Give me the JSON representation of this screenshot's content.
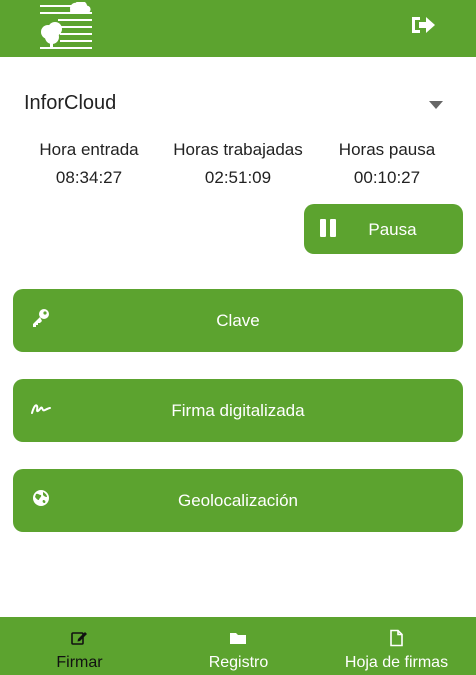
{
  "app": {
    "brand_color": "#5ca32f",
    "logo_icon": "tree-cloud-logo",
    "logout_icon": "logout-icon"
  },
  "company": {
    "selected": "InforCloud"
  },
  "stats": [
    {
      "label": "Hora entrada",
      "value": "08:34:27"
    },
    {
      "label": "Horas trabajadas",
      "value": "02:51:09"
    },
    {
      "label": "Horas pausa",
      "value": "00:10:27"
    }
  ],
  "pause_button": {
    "label": "Pausa",
    "icon": "pause-icon"
  },
  "actions": [
    {
      "label": "Clave",
      "icon": "key-icon"
    },
    {
      "label": "Firma digitalizada",
      "icon": "signature-icon"
    },
    {
      "label": "Geolocalización",
      "icon": "globe-icon"
    }
  ],
  "bottom_nav": [
    {
      "label": "Firmar",
      "icon": "edit-icon",
      "active": true
    },
    {
      "label": "Registro",
      "icon": "folder-icon",
      "active": false
    },
    {
      "label": "Hoja de firmas",
      "icon": "file-icon",
      "active": false
    }
  ]
}
